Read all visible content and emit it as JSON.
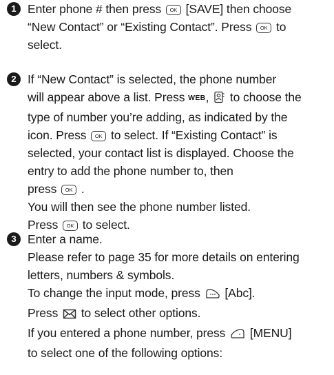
{
  "keys": {
    "ok": "OK",
    "web": "WEB"
  },
  "step1": {
    "number": "1",
    "text_a": "Enter phone # then press",
    "text_b": "[SAVE] then choose",
    "text_c": "“New Contact” or “Existing Contact”. Press",
    "text_d": "to",
    "text_e": "select."
  },
  "step2": {
    "number": "2",
    "line1": "If “New Contact” is selected, the phone number",
    "line2": "will appear above a list. Press",
    "line2_sep": ",",
    "line2_b": "to choose the",
    "line3": "type of number you’re adding, as indicated by the",
    "line4a": "icon. Press",
    "line4b": "to select. If “Existing Contact” is",
    "line5": "selected, your contact list is displayed. Choose the",
    "line6": "entry to add the phone number to, then",
    "line7a": "press",
    "line7b": ".",
    "line8": "You will then see the phone number listed.",
    "line9a": "Press",
    "line9b": "to select."
  },
  "step3": {
    "number": "3",
    "line1": "Enter a name.",
    "line2": "Please refer to page 35 for more details on entering",
    "line3": "letters, numbers & symbols.",
    "line4a": "To change the input mode, press",
    "line4b": "[Abc].",
    "line5a": "Press",
    "line5b": "to select other options.",
    "line6a": "If you entered a phone number, press",
    "line6b": "[MENU]",
    "line7": "to select one of the following options:"
  }
}
